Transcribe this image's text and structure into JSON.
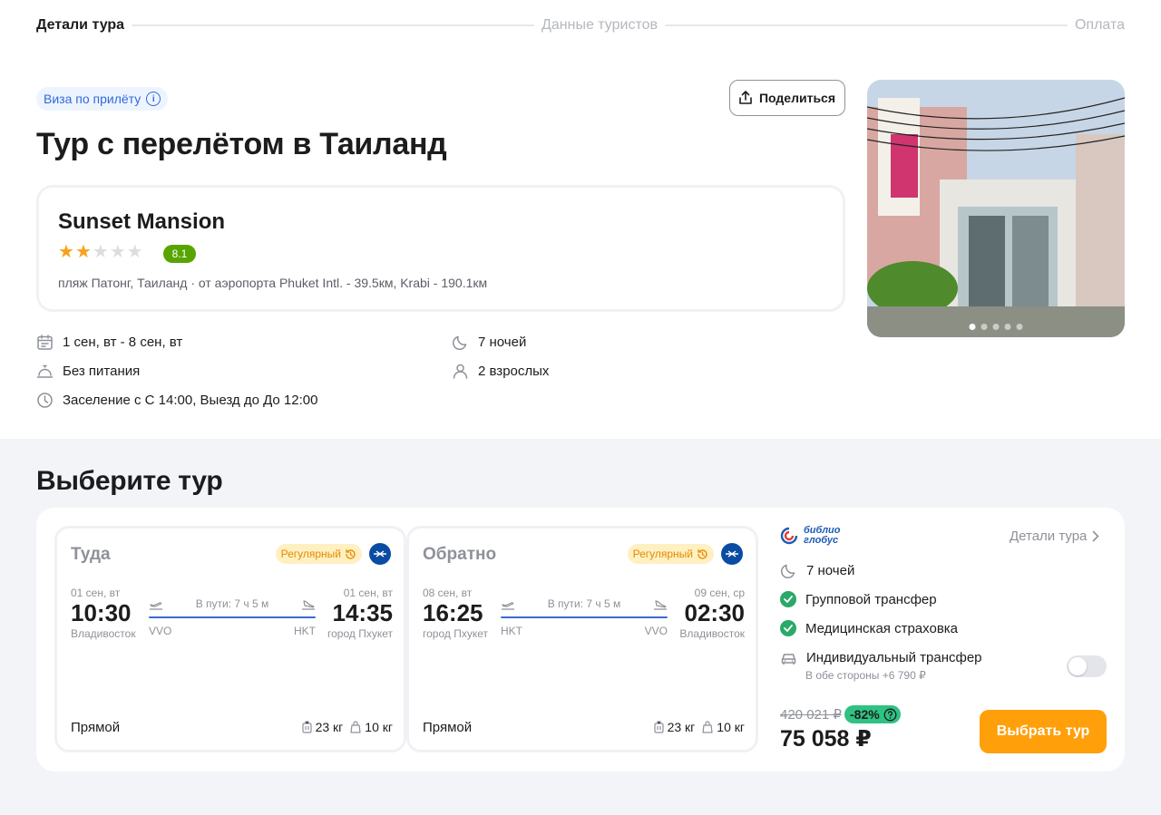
{
  "stepper": {
    "step1": "Детали тура",
    "step2": "Данные туристов",
    "step3": "Оплата"
  },
  "header": {
    "visa_chip": "Виза по прилёту",
    "share_label": "Поделиться",
    "title": "Тур с перелётом в Таиланд"
  },
  "hotel": {
    "name": "Sunset Mansion",
    "stars": 2,
    "max_stars": 5,
    "rating": "8.1",
    "location": "пляж Патонг, Таиланд · от аэропорта Phuket Intl. - 39.5км, Krabi - 190.1км"
  },
  "details": {
    "dates": "1 сен, вт - 8 сен, вт",
    "nights": "7 ночей",
    "meals": "Без питания",
    "guests": "2 взрослых",
    "checkin": "Заселение с С 14:00, Выезд до До 12:00"
  },
  "photo": {
    "slides": 5,
    "active_slide": 1
  },
  "section_title": "Выберите тур",
  "flights": [
    {
      "title": "Туда",
      "badge": "Регулярный",
      "dep_date": "01 сен, вт",
      "arr_date": "01 сен, вт",
      "dep_time": "10:30",
      "arr_time": "14:35",
      "dep_city": "Владивосток",
      "arr_city": "город Пхукет",
      "duration": "В пути: 7 ч 5 м",
      "dep_code": "VVO",
      "arr_code": "HKT",
      "type": "Прямой",
      "baggage": "23 кг",
      "hand_luggage": "10 кг"
    },
    {
      "title": "Обратно",
      "badge": "Регулярный",
      "dep_date": "08 сен, вт",
      "arr_date": "09 сен, ср",
      "dep_time": "16:25",
      "arr_time": "02:30",
      "dep_city": "город Пхукет",
      "arr_city": "Владивосток",
      "duration": "В пути: 7 ч 5 м",
      "dep_code": "HKT",
      "arr_code": "VVO",
      "type": "Прямой",
      "baggage": "23 кг",
      "hand_luggage": "10 кг"
    }
  ],
  "offer": {
    "operator_line1": "библио",
    "operator_line2": "глобус",
    "details_link": "Детали тура",
    "nights": "7 ночей",
    "group_transfer": "Групповой трансфер",
    "insurance": "Медицинская страховка",
    "individual_transfer": "Индивидуальный трансфер",
    "individual_transfer_price": "В обе стороны +6 790 ₽",
    "individual_transfer_on": false,
    "old_price": "420 021 ₽",
    "discount": "-82%",
    "price": "75 058 ₽",
    "choose_label": "Выбрать тур"
  },
  "colors": {
    "accent": "#ff9f0a",
    "link": "#2e6bd8",
    "rating": "#58a500",
    "check": "#2aa96a",
    "route": "#3d6ad6"
  }
}
